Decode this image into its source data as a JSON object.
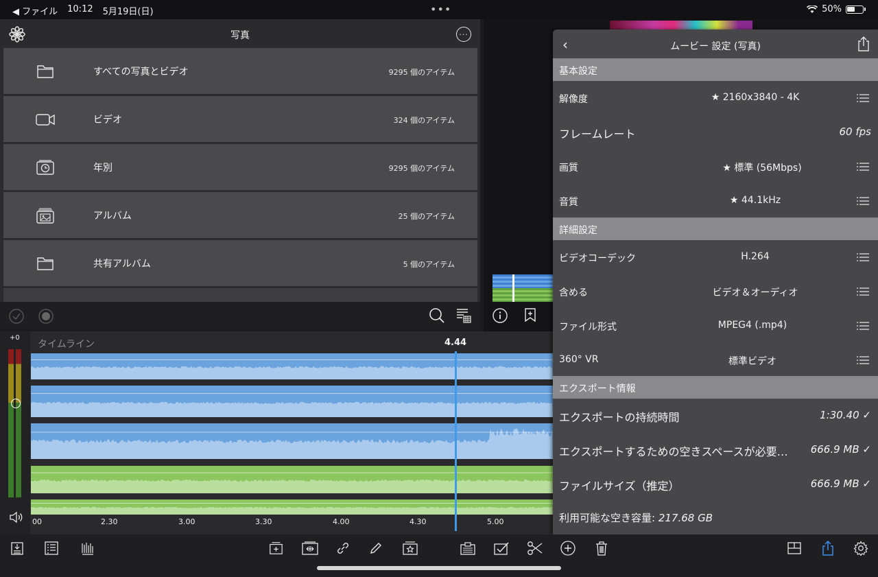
{
  "statusbar": {
    "back_app": "◀ ファイル",
    "time": "10:12",
    "date": "5月19日(日)",
    "battery": "50%"
  },
  "photos": {
    "title": "写真",
    "rows": [
      {
        "label": "すべての写真とビデオ",
        "count": "9295 個のアイテム",
        "icon": "folder-icon"
      },
      {
        "label": "ビデオ",
        "count": "324 個のアイテム",
        "icon": "video-camera-icon"
      },
      {
        "label": "年別",
        "count": "9295 個のアイテム",
        "icon": "calendar-clock-icon"
      },
      {
        "label": "アルバム",
        "count": "25 個のアイテム",
        "icon": "album-stack-icon"
      },
      {
        "label": "共有アルバム",
        "count": "5 個のアイテム",
        "icon": "folder-icon"
      }
    ]
  },
  "timeline": {
    "label": "タイムライン",
    "playhead_time": "4.44",
    "meter_db": "+0",
    "ruler": [
      "00",
      "2.30",
      "3.00",
      "3.30",
      "4.00",
      "4.30",
      "5.00"
    ]
  },
  "settings": {
    "title": "ムービー 設定 (写真)",
    "sections": {
      "basic": "基本設定",
      "advanced": "詳細設定",
      "export": "エクスポート情報"
    },
    "resolution": {
      "label": "解像度",
      "value": "★ 2160x3840 - 4K"
    },
    "framerate": {
      "label": "フレームレート",
      "value": "60 fps"
    },
    "quality": {
      "label": "画質",
      "value": "★ 標準 (56Mbps)"
    },
    "audio": {
      "label": "音質",
      "value": "★ 44.1kHz"
    },
    "codec": {
      "label": "ビデオコーデック",
      "value": "H.264"
    },
    "include": {
      "label": "含める",
      "value": "ビデオ＆オーディオ"
    },
    "format": {
      "label": "ファイル形式",
      "value": "MPEG4 (.mp4)"
    },
    "vr": {
      "label": "360° VR",
      "value": "標準ビデオ"
    },
    "duration": {
      "label": "エクスポートの持続時間",
      "value": "1:30.40 ✓"
    },
    "space_needed": {
      "label": "エクスポートするための空きスペースが必要…",
      "value": "666.9 MB ✓"
    },
    "filesize": {
      "label": "ファイルサイズ（推定）",
      "value": "666.9 MB ✓"
    },
    "free_space": {
      "label": "利用可能な空き容量:",
      "value": "217.68 GB"
    }
  },
  "colors": {
    "video_track": "#6aa3de",
    "audio_track": "#8cc65e",
    "playhead": "#3f9ae8",
    "accent_blue": "#3d8ef0"
  }
}
